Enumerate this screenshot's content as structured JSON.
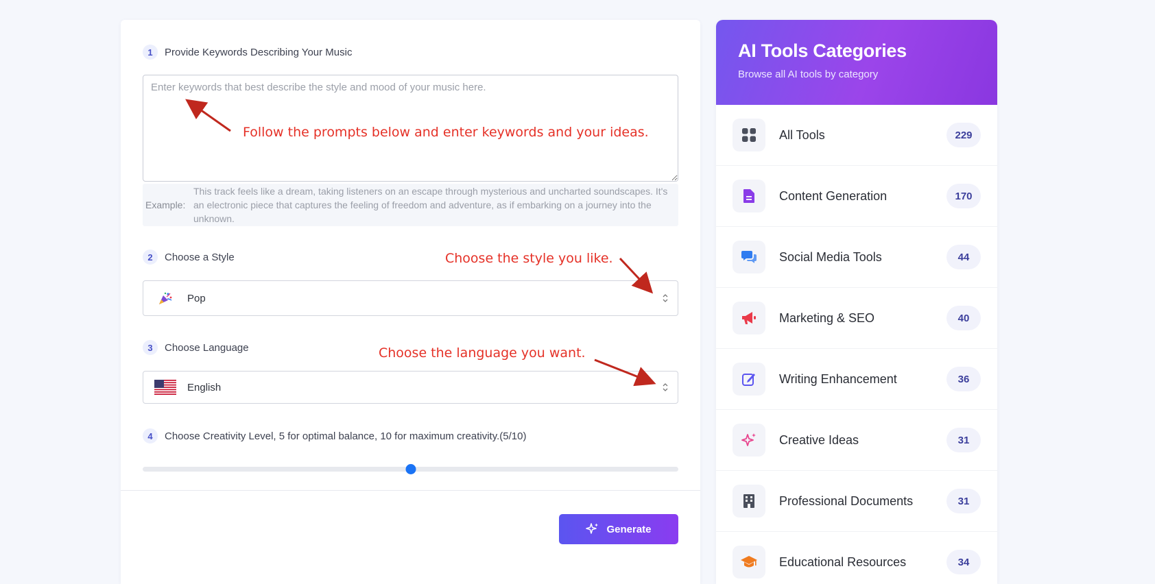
{
  "form": {
    "step1": {
      "num": "1",
      "label": "Provide Keywords Describing Your Music"
    },
    "keywords": {
      "placeholder": "Enter keywords that best describe the style and mood of your music here.",
      "value": ""
    },
    "example": {
      "key": "Example:",
      "text": "This track feels like a dream, taking listeners on an escape through mysterious and uncharted soundscapes. It's an electronic piece that captures the feeling of freedom and adventure, as if embarking on a journey into the unknown."
    },
    "step2": {
      "num": "2",
      "label": "Choose a Style"
    },
    "style_select": {
      "value": "Pop",
      "icon": "party-popper-icon"
    },
    "step3": {
      "num": "3",
      "label": "Choose Language"
    },
    "language_select": {
      "value": "English",
      "icon": "us-flag-icon"
    },
    "step4": {
      "num": "4",
      "label": "Choose Creativity Level, 5 for optimal balance, 10 for maximum creativity.(5/10)"
    },
    "creativity": {
      "value": 5,
      "min": 0,
      "max": 10
    },
    "generate_label": "Generate"
  },
  "annotations": {
    "keywords_hint": "Follow the prompts below and enter keywords and your ideas.",
    "style_hint": "Choose the style you like.",
    "language_hint": "Choose the language you want.",
    "color": "#e53127"
  },
  "categories": {
    "title": "AI Tools Categories",
    "subtitle": "Browse all AI tools by category",
    "items": [
      {
        "label": "All Tools",
        "count": "229",
        "icon": "grid-icon",
        "color": "#4a4f5c"
      },
      {
        "label": "Content Generation",
        "count": "170",
        "icon": "document-icon",
        "color": "#8a3ce8"
      },
      {
        "label": "Social Media Tools",
        "count": "44",
        "icon": "chat-bubbles-icon",
        "color": "#2f7cf0"
      },
      {
        "label": "Marketing & SEO",
        "count": "40",
        "icon": "megaphone-icon",
        "color": "#ea3a4a"
      },
      {
        "label": "Writing Enhancement",
        "count": "36",
        "icon": "edit-icon",
        "color": "#5b55f0"
      },
      {
        "label": "Creative Ideas",
        "count": "31",
        "icon": "sparkles-icon",
        "color": "#e8458e"
      },
      {
        "label": "Professional Documents",
        "count": "31",
        "icon": "building-icon",
        "color": "#4a4f5c"
      },
      {
        "label": "Educational Resources",
        "count": "34",
        "icon": "graduation-cap-icon",
        "color": "#f07b1f"
      }
    ]
  }
}
